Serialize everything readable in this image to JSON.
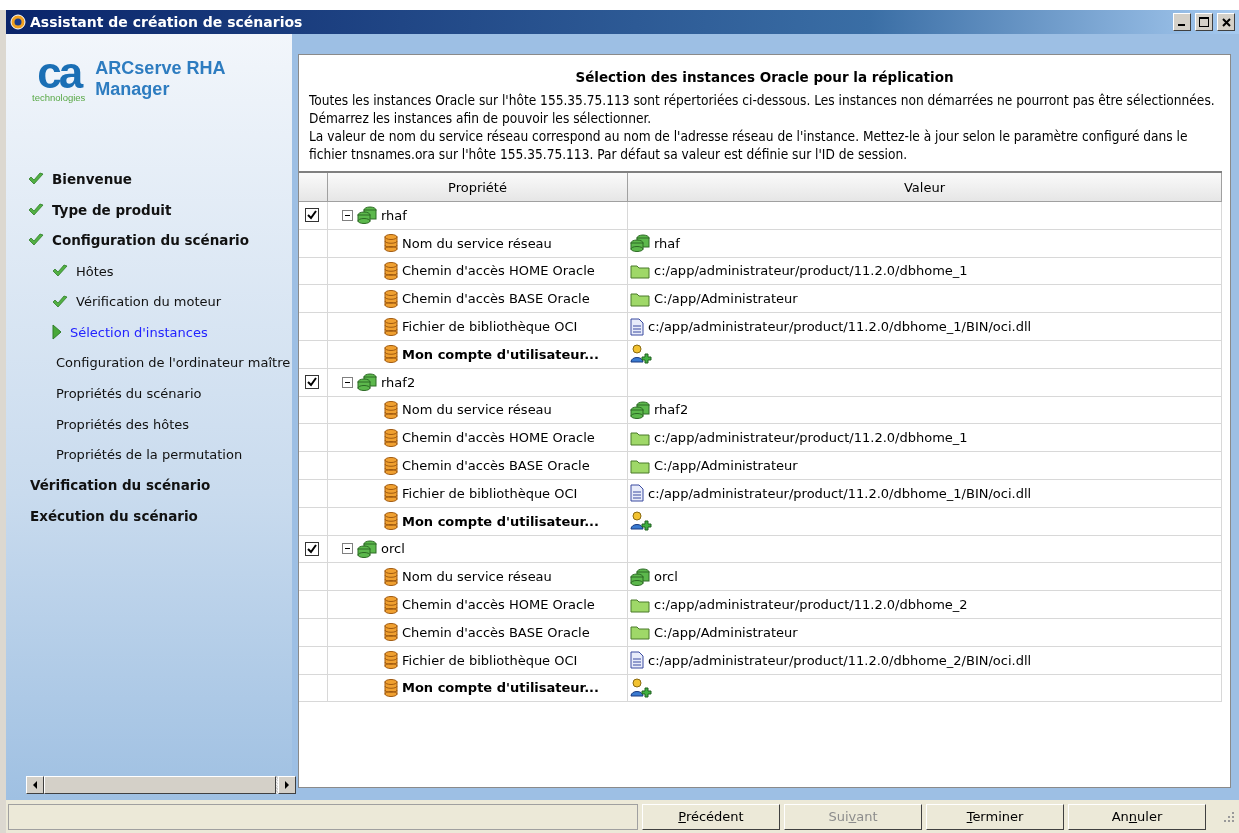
{
  "window": {
    "title": "Assistant de création de scénarios"
  },
  "logo": {
    "mark": "ca",
    "tagline": "technologies",
    "product": "ARCserve RHA Manager"
  },
  "steps": [
    {
      "label": "Bienvenue",
      "done": true,
      "selected": false
    },
    {
      "label": "Type de produit",
      "done": true,
      "selected": false
    },
    {
      "label": "Configuration du scénario",
      "done": true,
      "selected": false,
      "children": [
        {
          "label": "Hôtes",
          "done": true,
          "selected": false
        },
        {
          "label": "Vérification du moteur",
          "done": true,
          "selected": false
        },
        {
          "label": "Sélection d'instances",
          "done": false,
          "selected": true
        },
        {
          "label": "Configuration de l'ordinateur maître",
          "done": false,
          "selected": false
        },
        {
          "label": "Propriétés du scénario",
          "done": false,
          "selected": false
        },
        {
          "label": "Propriétés des hôtes",
          "done": false,
          "selected": false
        },
        {
          "label": "Propriétés de la permutation",
          "done": false,
          "selected": false
        }
      ]
    },
    {
      "label": "Vérification du scénario",
      "done": false,
      "selected": false
    },
    {
      "label": "Exécution du scénario",
      "done": false,
      "selected": false
    }
  ],
  "panel": {
    "heading": "Sélection des instances Oracle pour la réplication",
    "paragraphs": [
      "Toutes les instances Oracle sur l'hôte 155.35.75.113 sont répertoriées ci-dessous. Les instances non démarrées ne pourront pas être sélectionnées. Démarrez les instances afin de pouvoir les sélectionner.",
      "La valeur de nom du service réseau correspond au nom de l'adresse réseau de l'instance. Mettez-le à jour selon le paramètre configuré dans le fichier tnsnames.ora sur l'hôte 155.35.75.113. Par défaut sa valeur est définie sur l'ID de session."
    ]
  },
  "table": {
    "columns": [
      "Propriété",
      "Valeur"
    ],
    "instances": [
      {
        "name": "rhaf",
        "checked": true,
        "expanded": true,
        "properties": [
          {
            "label": "Nom du service réseau",
            "kind": "network",
            "value": "rhaf",
            "emphasis": false
          },
          {
            "label": "Chemin d'accès HOME Oracle",
            "kind": "folder",
            "value": "c:/app/administrateur/product/11.2.0/dbhome_1",
            "emphasis": false
          },
          {
            "label": "Chemin d'accès BASE Oracle",
            "kind": "folder",
            "value": "C:/app/Administrateur",
            "emphasis": false
          },
          {
            "label": "Fichier de bibliothèque OCI",
            "kind": "file",
            "value": "c:/app/administrateur/product/11.2.0/dbhome_1/BIN/oci.dll",
            "emphasis": false
          },
          {
            "label": "Mon compte d'utilisateur...",
            "kind": "account",
            "emphasis": true
          }
        ]
      },
      {
        "name": "rhaf2",
        "checked": true,
        "expanded": true,
        "properties": [
          {
            "label": "Nom du service réseau",
            "kind": "network",
            "value": "rhaf2",
            "emphasis": false
          },
          {
            "label": "Chemin d'accès HOME Oracle",
            "kind": "folder",
            "value": "c:/app/administrateur/product/11.2.0/dbhome_1",
            "emphasis": false
          },
          {
            "label": "Chemin d'accès BASE Oracle",
            "kind": "folder",
            "value": "C:/app/Administrateur",
            "emphasis": false
          },
          {
            "label": "Fichier de bibliothèque OCI",
            "kind": "file",
            "value": "c:/app/administrateur/product/11.2.0/dbhome_1/BIN/oci.dll",
            "emphasis": false
          },
          {
            "label": "Mon compte d'utilisateur...",
            "kind": "account",
            "emphasis": true
          }
        ]
      },
      {
        "name": "orcl",
        "checked": true,
        "expanded": true,
        "properties": [
          {
            "label": "Nom du service réseau",
            "kind": "network",
            "value": "orcl",
            "emphasis": false
          },
          {
            "label": "Chemin d'accès HOME Oracle",
            "kind": "folder",
            "value": "c:/app/administrateur/product/11.2.0/dbhome_2",
            "emphasis": false
          },
          {
            "label": "Chemin d'accès BASE Oracle",
            "kind": "folder",
            "value": "C:/app/Administrateur",
            "emphasis": false
          },
          {
            "label": "Fichier de bibliothèque OCI",
            "kind": "file",
            "value": "c:/app/administrateur/product/11.2.0/dbhome_2/BIN/oci.dll",
            "emphasis": false
          },
          {
            "label": "Mon compte d'utilisateur...",
            "kind": "account",
            "emphasis": true
          }
        ]
      }
    ]
  },
  "buttons": [
    {
      "key": "P",
      "after": "récédent",
      "disabled": false
    },
    {
      "before": "Sui",
      "key": "v",
      "after": "ant",
      "disabled": true
    },
    {
      "key": "T",
      "after": "erminer",
      "disabled": false
    },
    {
      "before": "An",
      "key": "n",
      "after": "uler",
      "disabled": false
    }
  ]
}
